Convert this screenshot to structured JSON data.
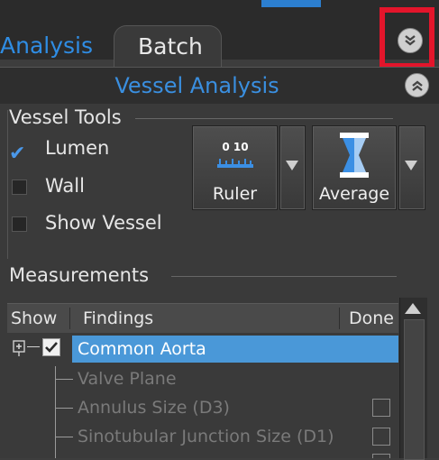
{
  "tabs": [
    {
      "label": "Analysis",
      "active": false
    },
    {
      "label": "Batch",
      "active": true
    }
  ],
  "header": {
    "title": "Vessel Analysis"
  },
  "collapse_icon": "collapse-up-icon",
  "expand_icon": "expand-down-icon",
  "vessel_tools": {
    "label": "Vessel Tools",
    "options": [
      {
        "label": "Lumen",
        "checked": true
      },
      {
        "label": "Wall",
        "checked": false
      },
      {
        "label": "Show Vessel",
        "checked": false
      }
    ],
    "ruler": {
      "label": "Ruler",
      "icon_text": "0 10"
    },
    "average": {
      "label": "Average"
    }
  },
  "measurements": {
    "label": "Measurements",
    "columns": [
      "Show",
      "Findings",
      "Done"
    ],
    "rows": [
      {
        "label": "Common Aorta",
        "selected": true,
        "checked": true
      },
      {
        "label": "Valve Plane",
        "has_done": false
      },
      {
        "label": "Annulus Size (D3)",
        "has_done": true
      },
      {
        "label": "Sinotubular Junction Size (D1)",
        "has_done": true
      }
    ]
  },
  "colors": {
    "accent": "#2f8de4",
    "highlight": "#e3152b",
    "selected_row": "#4a98d8"
  }
}
